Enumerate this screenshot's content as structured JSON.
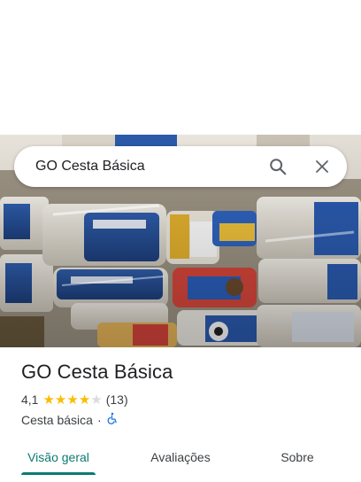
{
  "search": {
    "query": "GO Cesta Básica",
    "search_icon": "search-icon",
    "close_icon": "close-icon"
  },
  "photo": {
    "description_icon": "photo-packaged-food"
  },
  "place": {
    "title": "GO Cesta Básica",
    "rating": "4,1",
    "rating_value": 4.1,
    "stars_full": 4,
    "stars_total": 5,
    "review_count": "(13)",
    "category": "Cesta básica",
    "separator": "·",
    "accessibility_icon": "wheelchair-icon"
  },
  "tabs": [
    {
      "label": "Visão geral",
      "active": true
    },
    {
      "label": "Avaliações",
      "active": false
    },
    {
      "label": "Sobre",
      "active": false
    }
  ],
  "colors": {
    "accent": "#0b7a72",
    "star": "#fbbc04",
    "accessibility": "#1a73e8"
  }
}
